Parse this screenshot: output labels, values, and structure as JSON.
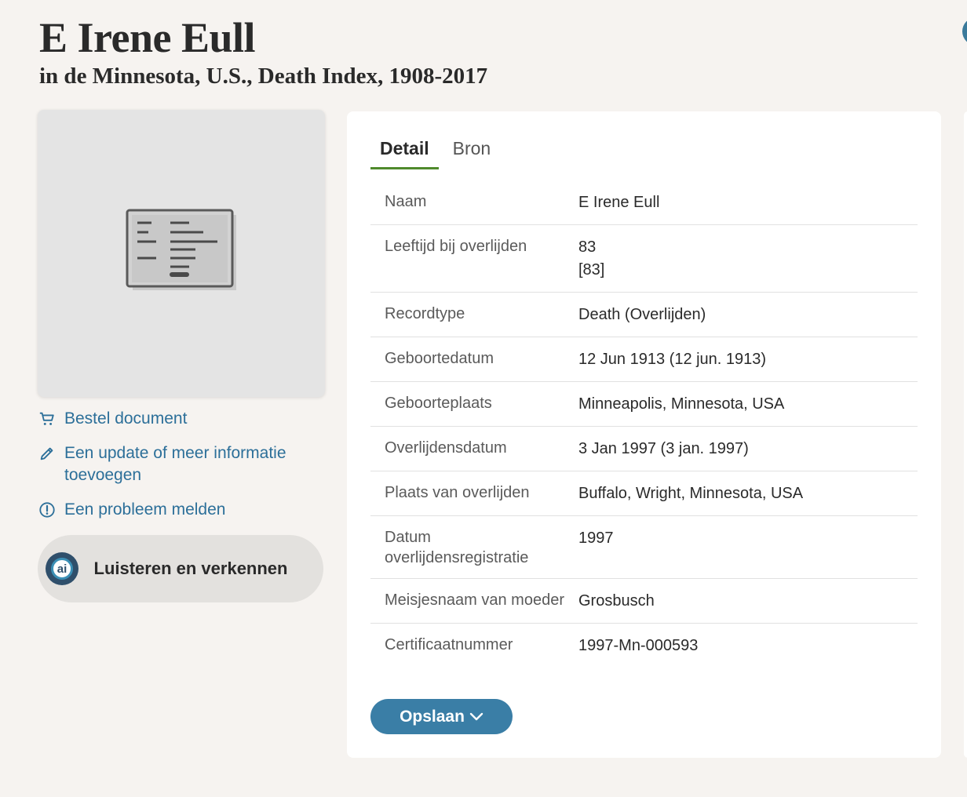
{
  "header": {
    "title": "E Irene Eull",
    "subtitle": "in de Minnesota, U.S., Death Index, 1908-2017"
  },
  "actions": {
    "order_document": "Bestel document",
    "add_update": "Een update of meer informatie toevoegen",
    "report_problem": "Een probleem melden"
  },
  "listen": {
    "icon_text": "ai",
    "label": "Luisteren en verkennen"
  },
  "tabs": [
    {
      "label": "Detail",
      "active": true
    },
    {
      "label": "Bron",
      "active": false
    }
  ],
  "details": [
    {
      "label": "Naam",
      "value": "E Irene Eull",
      "value2": ""
    },
    {
      "label": "Leeftijd bij overlijden",
      "value": "83",
      "value2": "[83]"
    },
    {
      "label": "Recordtype",
      "value": "Death (Overlijden)",
      "value2": ""
    },
    {
      "label": "Geboortedatum",
      "value": "12 Jun 1913 (12 jun. 1913)",
      "value2": ""
    },
    {
      "label": "Geboorteplaats",
      "value": "Minneapolis, Minnesota, USA",
      "value2": ""
    },
    {
      "label": "Overlijdensdatum",
      "value": "3 Jan 1997 (3 jan. 1997)",
      "value2": ""
    },
    {
      "label": "Plaats van overlijden",
      "value": "Buffalo, Wright, Minnesota, USA",
      "value2": ""
    },
    {
      "label": "Datum overlijdensregistratie",
      "value": "1997",
      "value2": ""
    },
    {
      "label": "Meisjesnaam van moeder",
      "value": "Grosbusch",
      "value2": ""
    },
    {
      "label": "Certificaatnummer",
      "value": "1997-Mn-000593",
      "value2": ""
    }
  ],
  "save_button": {
    "label": "Opslaan"
  },
  "colors": {
    "link": "#2c6f99",
    "tab_underline": "#4f8a2c",
    "save_button": "#3a7ea6",
    "background": "#f6f3f0"
  }
}
